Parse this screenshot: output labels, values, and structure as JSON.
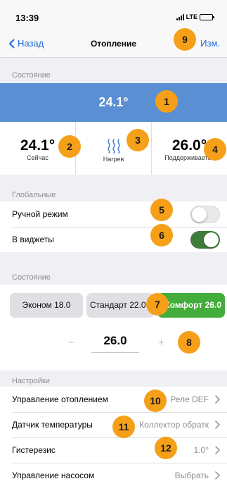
{
  "status_bar": {
    "time": "13:39",
    "network": "LTE"
  },
  "nav": {
    "back_label": "Назад",
    "title": "Отопление",
    "edit_label": "Изм."
  },
  "state_section": {
    "header": "Состояние",
    "current_temp": "24.1°",
    "now": {
      "value": "24.1°",
      "label": "Сейчас"
    },
    "mode": {
      "icon": "heat-waves-icon",
      "label": "Нагрев"
    },
    "maintained": {
      "value": "26.0°",
      "label": "Поддерживается"
    }
  },
  "global_section": {
    "header": "Глобальные",
    "manual_mode": {
      "label": "Ручной режим",
      "enabled": false
    },
    "in_widgets": {
      "label": "В виджеты",
      "enabled": true
    }
  },
  "presets_section": {
    "header": "Состояние",
    "presets": [
      {
        "label": "Эконом 18.0",
        "active": false
      },
      {
        "label": "Стандарт 22.0",
        "active": false
      },
      {
        "label": "Комфорт 26.0",
        "active": true
      }
    ],
    "stepper": {
      "minus": "−",
      "value": "26.0",
      "plus": "+"
    }
  },
  "settings_section": {
    "header": "Настройки",
    "rows": [
      {
        "label": "Управление отоплением",
        "value": "Реле DEF"
      },
      {
        "label": "Датчик температуры",
        "value": "Коллектор обратк"
      },
      {
        "label": "Гистерезис",
        "value": "1.0°"
      },
      {
        "label": "Управление насосом",
        "value": "Выбрать"
      }
    ]
  },
  "annotations": [
    "1",
    "2",
    "3",
    "4",
    "5",
    "6",
    "7",
    "8",
    "9",
    "10",
    "11",
    "12"
  ],
  "colors": {
    "accent_blue": "#1e6ad9",
    "banner_blue": "#5b8fd4",
    "active_green": "#43ad3b",
    "toggle_on": "#3f7b3a",
    "badge_orange": "#f5a018"
  }
}
